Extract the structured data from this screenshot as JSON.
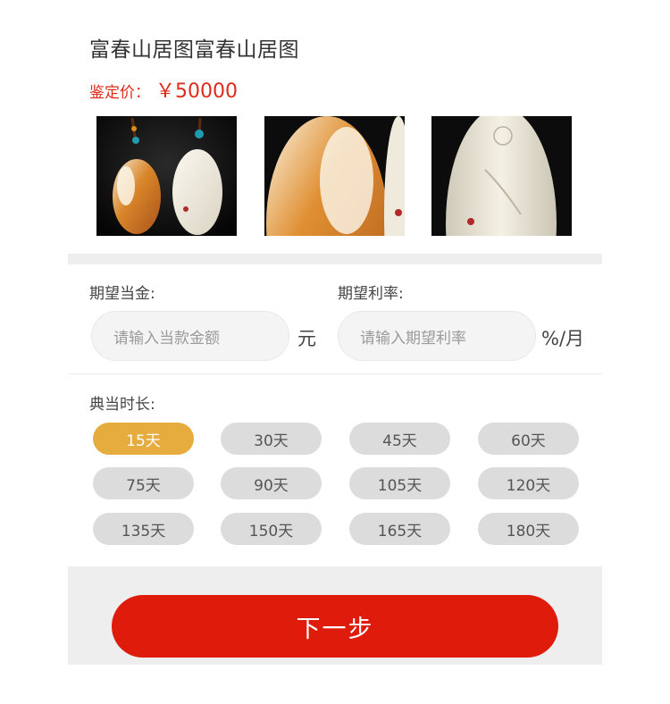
{
  "product": {
    "title": "富春山居图富春山居图",
    "price_label": "鉴定价：",
    "price_value": "￥50000"
  },
  "images": [
    "jade-pendant-pair",
    "jade-pendant-closeup",
    "jade-pendant-detail"
  ],
  "form": {
    "amount_label": "期望当金:",
    "amount_placeholder": "请输入当款金额",
    "amount_unit": "元",
    "rate_label": "期望利率:",
    "rate_placeholder": "请输入期望利率",
    "rate_unit": "%/月"
  },
  "duration": {
    "label": "典当时长:",
    "selected": "15天",
    "options": [
      "15天",
      "30天",
      "45天",
      "60天",
      "75天",
      "90天",
      "105天",
      "120天",
      "135天",
      "150天",
      "165天",
      "180天"
    ]
  },
  "next_button": "下一步",
  "colors": {
    "accent_red": "#df1c0c",
    "price_red": "#e02a1a",
    "selected_gold": "#e6ac3e",
    "chip_gray": "#dcdcdc"
  }
}
